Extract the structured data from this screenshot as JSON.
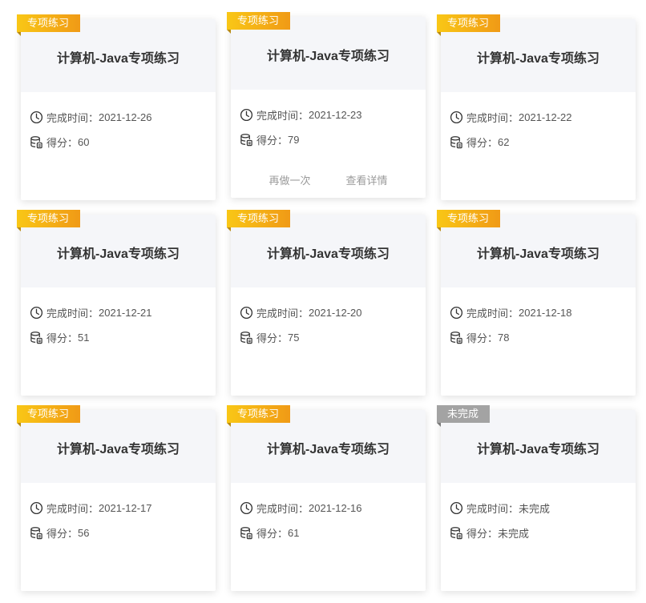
{
  "labels": {
    "time_prefix": "完成时间：",
    "score_prefix": "得分："
  },
  "colors": {
    "tag_gradient_start": "#f9c716",
    "tag_gradient_end": "#f09a16",
    "tag_incomplete": "#a3a3a3",
    "card_header_bg": "#f5f6f9"
  },
  "icons": {
    "time": "clock-icon",
    "score": "database-score-icon"
  },
  "cards": [
    {
      "tag": "专项练习",
      "title": "计算机-Java专项练习",
      "time": "2021-12-26",
      "score": "60"
    },
    {
      "tag": "专项练习",
      "title": "计算机-Java专项练习",
      "time": "2021-12-23",
      "score": "79",
      "actions": {
        "retry": "再做一次",
        "details": "查看详情"
      }
    },
    {
      "tag": "专项练习",
      "title": "计算机-Java专项练习",
      "time": "2021-12-22",
      "score": "62"
    },
    {
      "tag": "专项练习",
      "title": "计算机-Java专项练习",
      "time": "2021-12-21",
      "score": "51"
    },
    {
      "tag": "专项练习",
      "title": "计算机-Java专项练习",
      "time": "2021-12-20",
      "score": "75"
    },
    {
      "tag": "专项练习",
      "title": "计算机-Java专项练习",
      "time": "2021-12-18",
      "score": "78"
    },
    {
      "tag": "专项练习",
      "title": "计算机-Java专项练习",
      "time": "2021-12-17",
      "score": "56"
    },
    {
      "tag": "专项练习",
      "title": "计算机-Java专项练习",
      "time": "2021-12-16",
      "score": "61"
    },
    {
      "tag": "未完成",
      "title": "计算机-Java专项练习",
      "time": "未完成",
      "score": "未完成"
    }
  ]
}
